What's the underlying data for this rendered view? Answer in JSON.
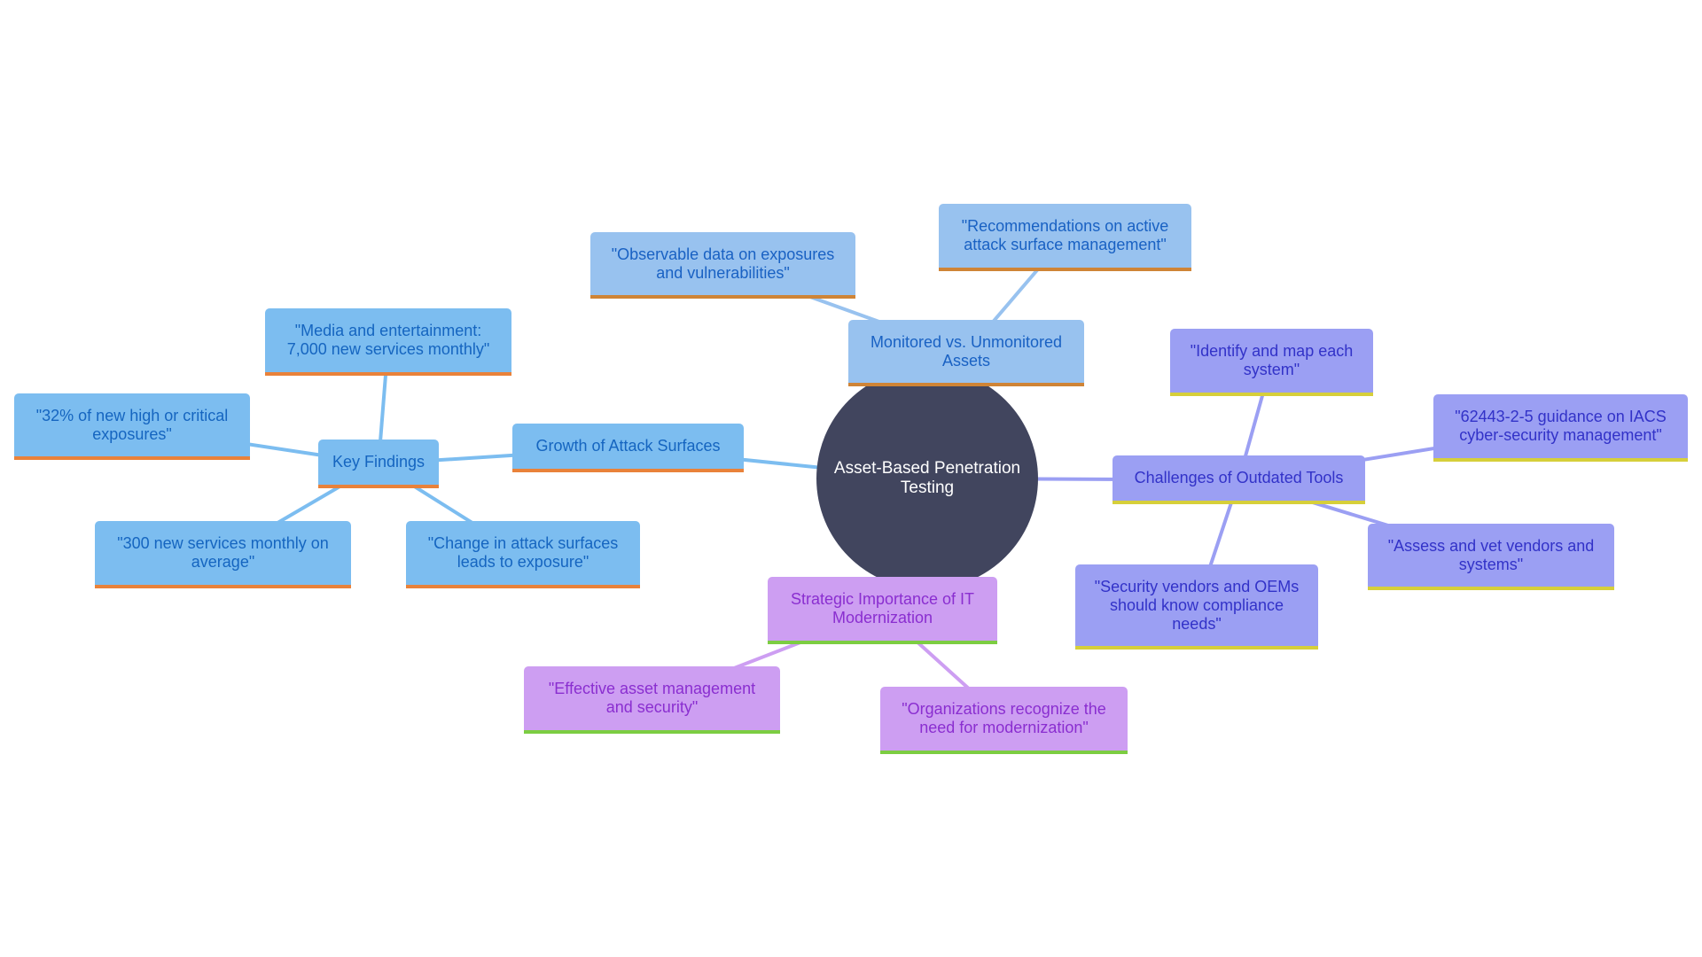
{
  "diagram": {
    "type": "mindmap",
    "colors": {
      "root_fill": "#41455e",
      "root_text": "#ffffff",
      "blue_branch_line": "#7cbdf0",
      "lightblue_branch_line": "#98c2ef",
      "indigo_branch_line": "#9b9ff3",
      "purple_branch_line": "#cd9ef2"
    },
    "root": {
      "label": "Asset-Based Penetration Testing"
    },
    "branches": {
      "growth": {
        "label": "Growth of Attack Surfaces",
        "children": {
          "key_findings": {
            "label": "Key Findings",
            "children": [
              {
                "label": "\"Media and entertainment: 7,000 new services monthly\""
              },
              {
                "label": "\"32% of new high or critical exposures\""
              },
              {
                "label": "\"300 new services monthly on average\""
              },
              {
                "label": "\"Change in attack surfaces leads to exposure\""
              }
            ]
          }
        }
      },
      "monitored": {
        "label": "Monitored vs. Unmonitored Assets",
        "children": [
          {
            "label": "\"Observable data on exposures and vulnerabilities\""
          },
          {
            "label": "\"Recommendations on active attack surface management\""
          }
        ]
      },
      "challenges": {
        "label": "Challenges of Outdated Tools",
        "children": [
          {
            "label": "\"Identify and map each system\""
          },
          {
            "label": "\"62443-2-5 guidance on IACS cyber-security management\""
          },
          {
            "label": "\"Assess and vet vendors and systems\""
          },
          {
            "label": "\"Security vendors and OEMs should know compliance needs\""
          }
        ]
      },
      "strategic": {
        "label": "Strategic Importance of IT Modernization",
        "children": [
          {
            "label": "\"Effective asset management and security\""
          },
          {
            "label": "\"Organizations recognize the need for modernization\""
          }
        ]
      }
    }
  }
}
